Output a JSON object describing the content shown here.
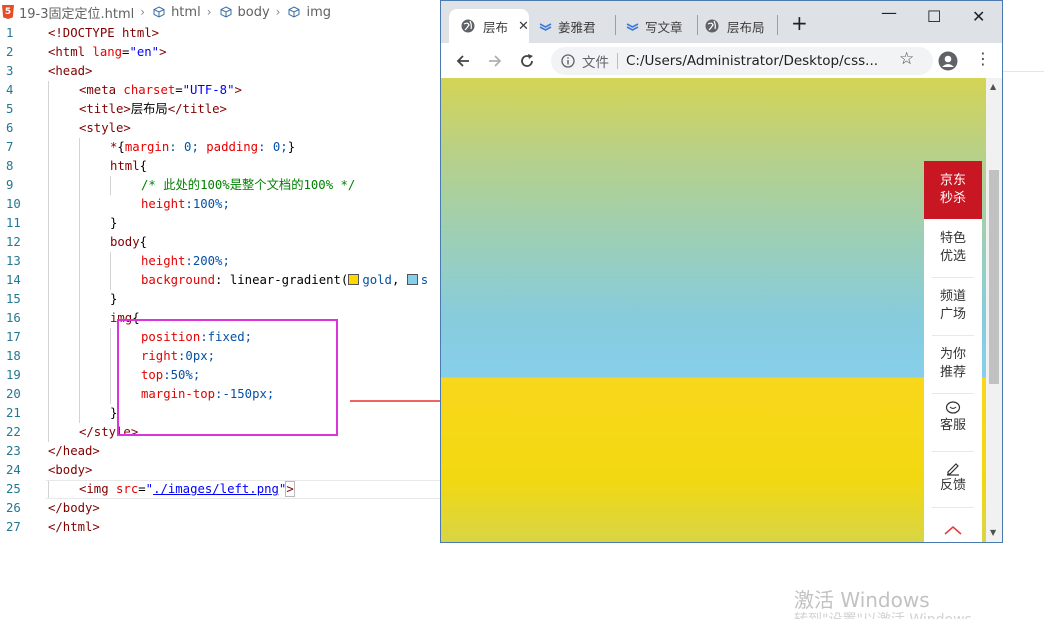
{
  "breadcrumb": {
    "file": "19-3固定定位.html",
    "items": [
      "html",
      "body",
      "img"
    ]
  },
  "editor": {
    "line_numbers": [
      "1",
      "2",
      "3",
      "4",
      "5",
      "6",
      "7",
      "8",
      "9",
      "10",
      "11",
      "12",
      "13",
      "14",
      "15",
      "16",
      "17",
      "18",
      "19",
      "20",
      "21",
      "22",
      "23",
      "24",
      "25",
      "26",
      "27"
    ],
    "lines": {
      "l1": "<!DOCTYPE html>",
      "l2_open": "<html ",
      "l2_attr": "lang",
      "l2_eq": "=",
      "l2_val": "\"en\"",
      "l2_close": ">",
      "l3": "<head>",
      "l4_open": "<meta ",
      "l4_attr": "charset",
      "l4_eq": "=",
      "l4_val": "\"UTF-8\"",
      "l4_close": ">",
      "l5_open": "<title>",
      "l5_text": "层布局",
      "l5_close": "</title>",
      "l6": "<style>",
      "l7_sel": "*",
      "l7_b1": "{",
      "l7_p1": "margin",
      "l7_v1": ": 0; ",
      "l7_p2": "padding",
      "l7_v2": ": 0;",
      "l7_b2": "}",
      "l8_sel": "html",
      "l8_b": "{",
      "l9": "/* 此处的100%是整个文档的100% */",
      "l10_p": "height",
      "l10_v": ":100%;",
      "l11": "}",
      "l12_sel": "body",
      "l12_b": "{",
      "l13_p": "height",
      "l13_v": ":200%;",
      "l14_p": "background",
      "l14_c": ": linear-gradient(",
      "l14_v1": "gold",
      "l14_sep": ", ",
      "l14_v2": "s",
      "l15": "}",
      "l16_sel": "img",
      "l16_b": "{",
      "l17_p": "position",
      "l17_v": ":fixed;",
      "l18_p": "right",
      "l18_v": ":0px;",
      "l19_p": "top",
      "l19_v": ":50%;",
      "l20_p": "margin-top",
      "l20_v": ":-150px;",
      "l21": "}",
      "l22": "</style>",
      "l23": "</head>",
      "l24": "<body>",
      "l25_open": "<img ",
      "l25_attr": "src",
      "l25_eq": "=",
      "l25_q1": "\"",
      "l25_link": "./images/left.png",
      "l25_q2": "\"",
      "l25_close": ">",
      "l26": "</body>",
      "l27": "</html>"
    }
  },
  "browser": {
    "tabs": [
      {
        "label": "层布",
        "active": true
      },
      {
        "label": "姜雅君"
      },
      {
        "label": "写文章"
      },
      {
        "label": "层布局"
      }
    ],
    "new_tab": "+",
    "window_controls": {
      "minimize": "—",
      "maximize": "☐",
      "close": "✕"
    },
    "address": {
      "security_label": "文件",
      "url": "C:/Users/Administrator/Desktop/css..."
    },
    "page_background_colors": {
      "gradient_start": "#d4d455",
      "mid": "#87ceeb",
      "gold": "#f9d71c"
    }
  },
  "side_panel": {
    "items": [
      {
        "line1": "京东",
        "line2": "秒杀"
      },
      {
        "line1": "特色",
        "line2": "优选"
      },
      {
        "line1": "频道",
        "line2": "广场"
      },
      {
        "line1": "为你",
        "line2": "推荐"
      },
      {
        "line1": "客服"
      },
      {
        "line1": "反馈"
      }
    ],
    "accent_color": "#c81623"
  },
  "watermark": {
    "line1": "激活 Windows",
    "line2": "转到\"设置\"以激活 Windows。"
  },
  "annotation_colors": {
    "box": "#dd33dd",
    "arrow": "#e8312f"
  }
}
